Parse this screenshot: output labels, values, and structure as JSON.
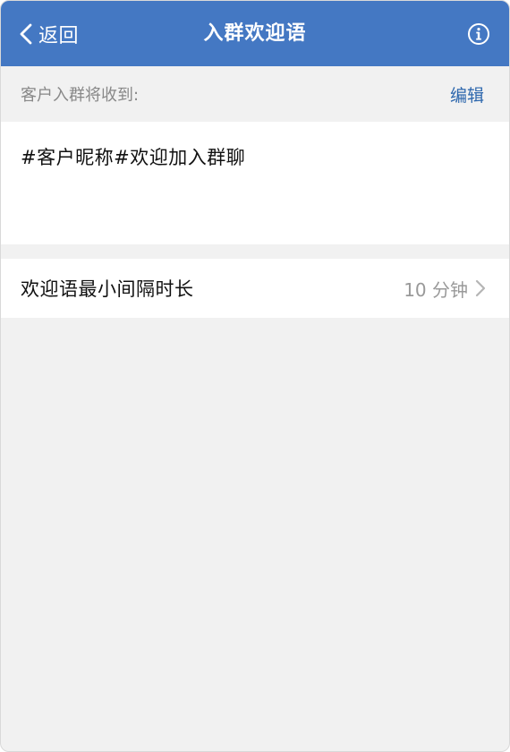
{
  "navbar": {
    "back_label": "返回",
    "title": "入群欢迎语",
    "info_icon": "info-circle-icon",
    "background_color": "#4478c3"
  },
  "welcome": {
    "section_label": "客户入群将收到:",
    "edit_label": "编辑",
    "message": "#客户昵称#欢迎加入群聊"
  },
  "settings": {
    "min_interval_label": "欢迎语最小间隔时长",
    "min_interval_value": "10 分钟"
  },
  "colors": {
    "accent": "#2d67ad",
    "page_background": "#f1f1f1"
  }
}
